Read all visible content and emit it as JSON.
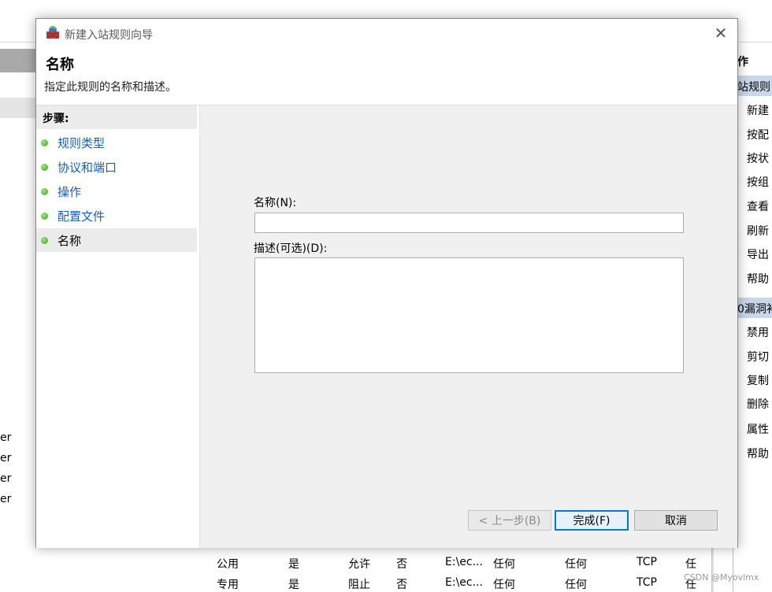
{
  "background": {
    "left_items": [
      "er",
      "er",
      "er",
      "er"
    ],
    "right_title": "作",
    "right_sections": [
      {
        "label": "站规则",
        "items": [
          "新建",
          "按配",
          "按状",
          "按组",
          "查看",
          "刷新",
          "导出",
          "帮助"
        ]
      },
      {
        "label": "0漏洞补",
        "items": [
          "禁用",
          "剪切",
          "复制",
          "删除",
          "属性",
          "帮助"
        ]
      }
    ],
    "table_rows": [
      [
        "公用",
        "是",
        "允许",
        "否",
        "E:\\ec...",
        "任何",
        "任何",
        "TCP",
        "任"
      ],
      [
        "专用",
        "是",
        "阻止",
        "否",
        "E:\\ec...",
        "任何",
        "任何",
        "TCP",
        "任"
      ]
    ]
  },
  "dialog": {
    "title": "新建入站规则向导",
    "close_glyph": "✕",
    "header_title": "名称",
    "header_subtitle": "指定此规则的名称和描述。",
    "steps_heading": "步骤:",
    "steps": [
      {
        "label": "规则类型",
        "current": false
      },
      {
        "label": "协议和端口",
        "current": false
      },
      {
        "label": "操作",
        "current": false
      },
      {
        "label": "配置文件",
        "current": false
      },
      {
        "label": "名称",
        "current": true
      }
    ],
    "name_label": "名称(N):",
    "name_value": "",
    "desc_label": "描述(可选)(D):",
    "desc_value": "",
    "buttons": {
      "back": "< 上一步(B)",
      "finish": "完成(F)",
      "cancel": "取消"
    }
  },
  "watermark": "CSDN @Myovlmx"
}
